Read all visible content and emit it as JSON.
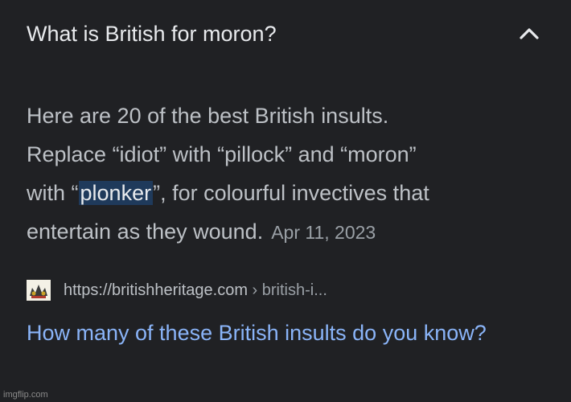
{
  "question": {
    "title": "What is British for moron?",
    "toggle_icon": "chevron-up-icon"
  },
  "answer": {
    "line1": "Here are 20 of the best British insults.",
    "line2": "Replace “idiot” with “pillock” and “moron”",
    "line3_prefix": "with “",
    "line3_highlight": "plonker",
    "line3_suffix": "”, for colourful invectives that",
    "line4": "entertain as they wound.",
    "date": "Apr 11, 2023"
  },
  "source": {
    "favicon": "britishheritage-logo-icon",
    "url": "https://britishheritage.com",
    "path": " › british-i..."
  },
  "result": {
    "link_text": "How many of these British insults do you know?"
  },
  "watermark": "imgflip.com",
  "colors": {
    "background": "#202124",
    "title": "#e8eaed",
    "body_text": "#bdc1c6",
    "muted": "#9aa0a6",
    "link": "#8ab4f8",
    "highlight_bg": "#1f3a5b"
  }
}
